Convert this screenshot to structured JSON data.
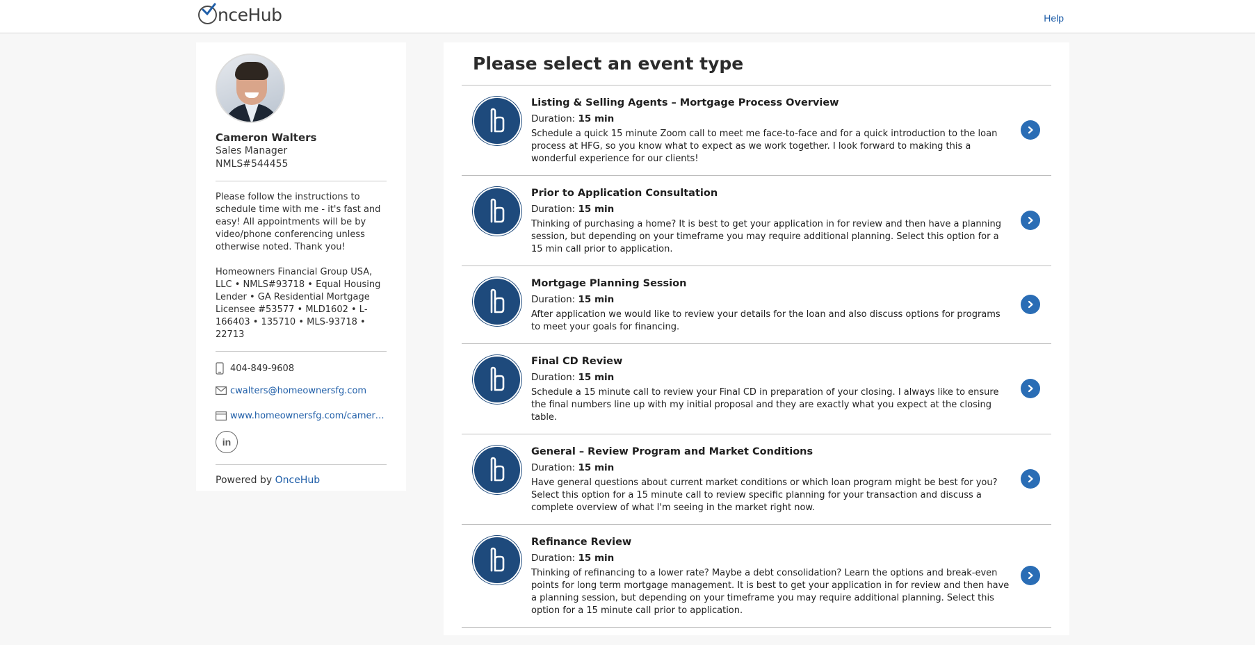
{
  "header": {
    "logo_text": "nceHub",
    "help_label": "Help"
  },
  "profile": {
    "name": "Cameron Walters",
    "role": "Sales Manager",
    "nmls": "NMLS#544455",
    "intro": "Please follow the instructions to schedule time with me - it's fast and easy! All appointments will be by video/phone conferencing unless otherwise noted. Thank you!",
    "company_info": "Homeowners Financial Group USA, LLC • NMLS#93718 • Equal Housing Lender • GA Residential Mortgage Licensee #53577 • MLD1602 • L-166403 • 135710 • MLS-93718 • 22713",
    "phone": "404-849-9608",
    "email": "cwalters@homeownersfg.com",
    "website": "www.homeownersfg.com/cameron...",
    "linkedin_label": "in",
    "powered_by_prefix": "Powered by",
    "powered_by_link": "OnceHub"
  },
  "main": {
    "title": "Please select an event type",
    "duration_label": "Duration:",
    "events": [
      {
        "title": "Listing & Selling Agents – Mortgage Process Overview",
        "duration": "15 min",
        "description": "Schedule a quick 15 minute Zoom call to meet me face-to-face and for a quick introduction to the loan process at HFG, so you know what to expect as we work together. I look forward to making this a wonderful experience for our clients!"
      },
      {
        "title": "Prior to Application Consultation",
        "duration": "15 min",
        "description": "Thinking of purchasing a home? It is best to get your application in for review and then have a planning session, but depending on your timeframe you may require additional planning. Select this option for a 15 min call prior to application."
      },
      {
        "title": "Mortgage Planning Session",
        "duration": "15 min",
        "description": "After application we would like to review your details for the loan and also discuss options for programs to meet your goals for financing."
      },
      {
        "title": "Final CD Review",
        "duration": "15 min",
        "description": "Schedule a 15 minute call to review your Final CD in preparation of your closing. I always like to ensure the final numbers line up with my initial proposal and they are exactly what you expect at the closing table."
      },
      {
        "title": "General – Review Program and Market Conditions",
        "duration": "15 min",
        "description": "Have general questions about current market conditions or which loan program might be best for you? Select this option for a 15 minute call to review specific planning for your transaction and discuss a complete overview of what I'm seeing in the market right now."
      },
      {
        "title": "Refinance Review",
        "duration": "15 min",
        "description": "Thinking of refinancing to a lower rate? Maybe a debt consolidation? Learn the options and break-even points for long term mortgage management. It is best to get your application in for review and then have a planning session, but depending on your timeframe you may require additional planning. Select this option for a 15 minute call prior to application."
      }
    ]
  },
  "colors": {
    "brand_blue": "#1e4a7c",
    "link_blue": "#1f5ea8",
    "arrow_blue": "#2a6db5"
  },
  "icons": {
    "event": "oncehub-mark-icon",
    "arrow": "chevron-right-icon",
    "phone": "phone-icon",
    "email": "envelope-icon",
    "website": "browser-icon",
    "linkedin": "linkedin-icon"
  }
}
